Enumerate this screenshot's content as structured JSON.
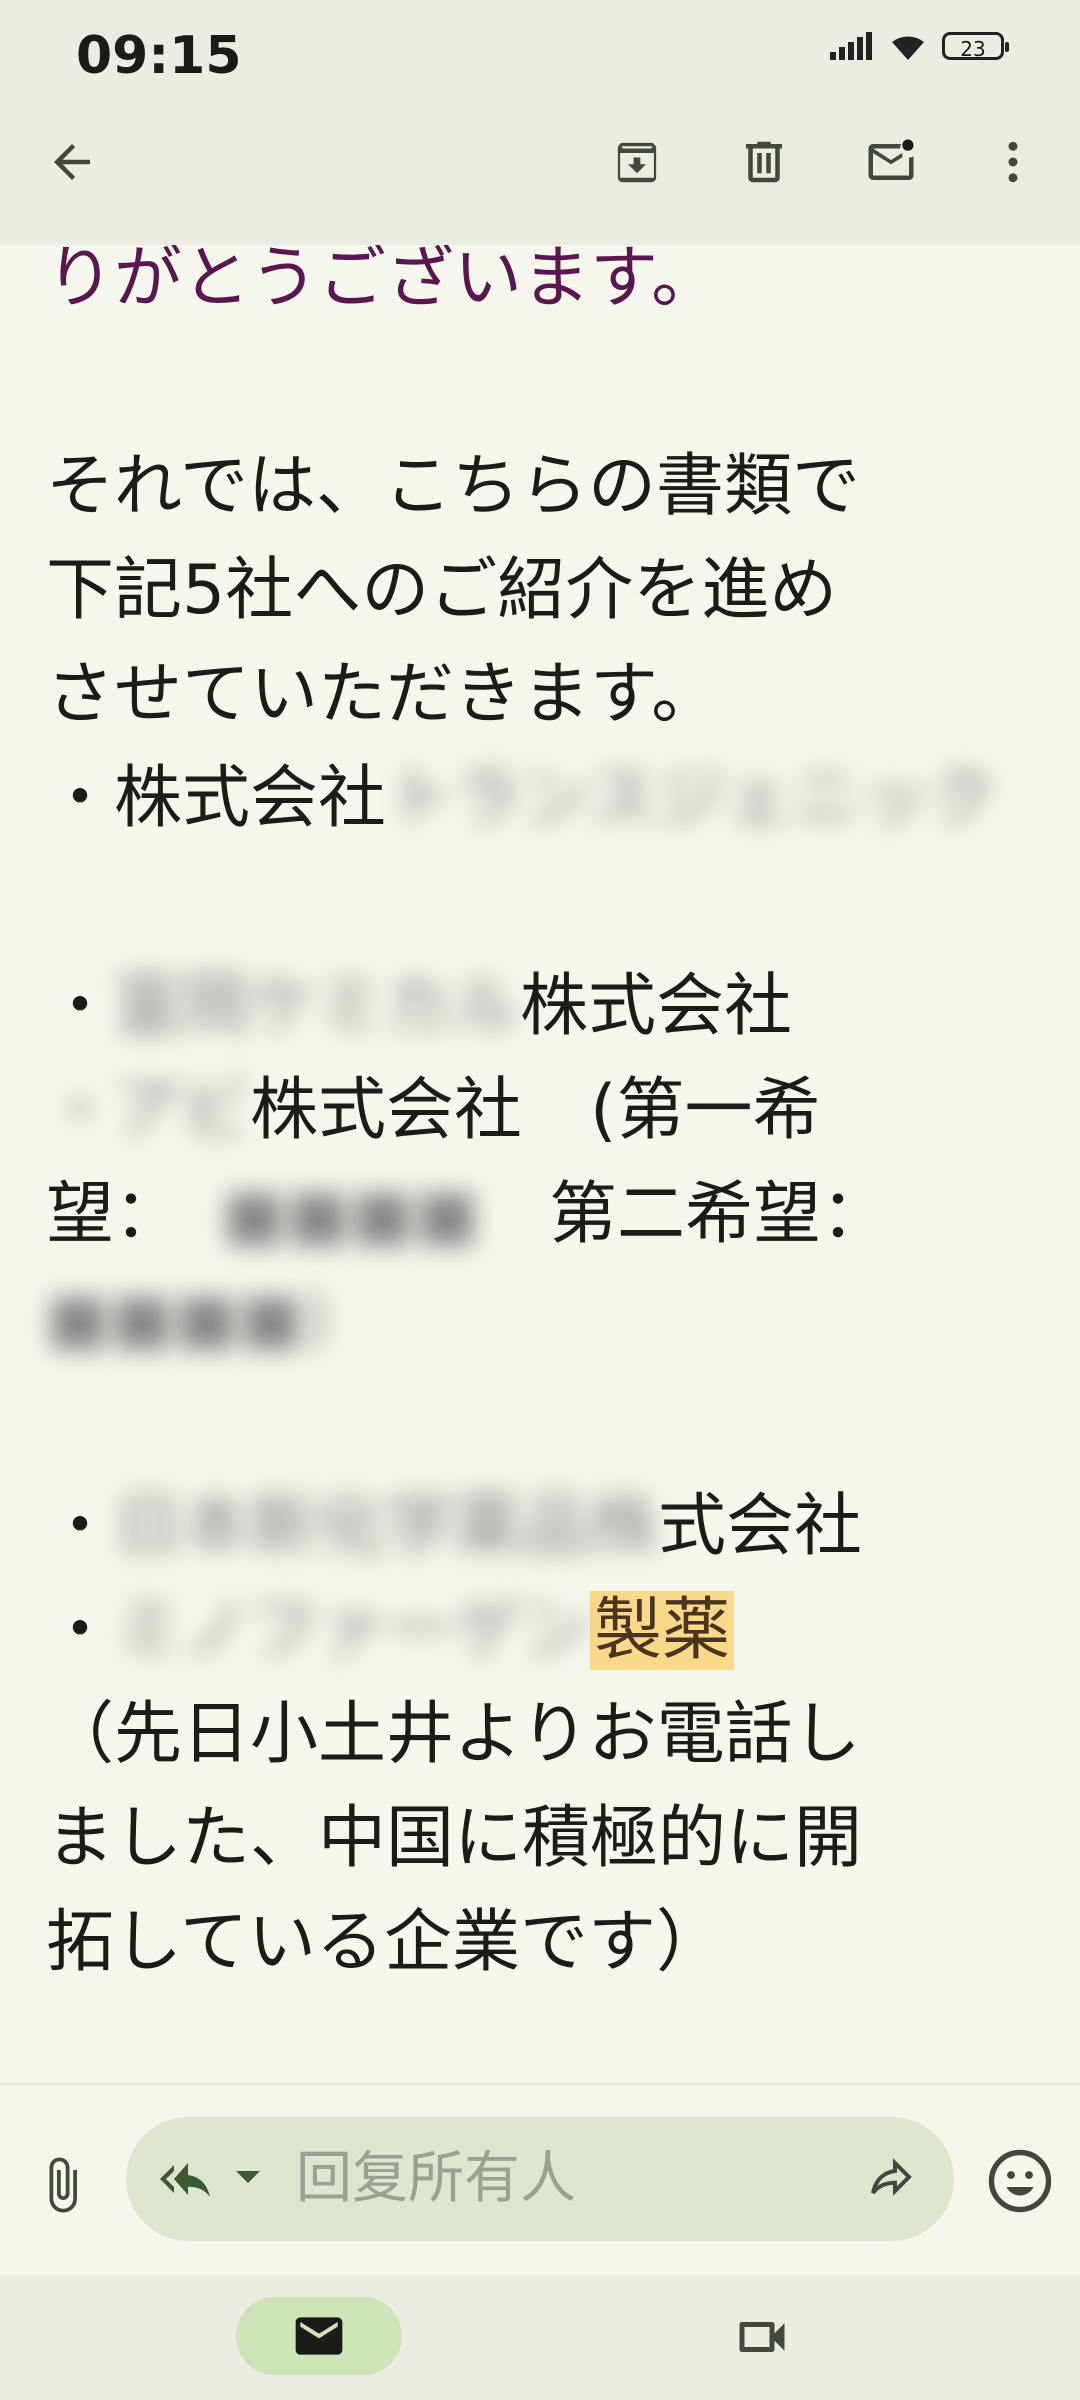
{
  "status_bar": {
    "time": "09:15",
    "battery": "23"
  },
  "toolbar": {
    "back": "back-arrow-icon",
    "archive": "archive-icon",
    "delete": "delete-icon",
    "mark_unread": "mark-unread-icon",
    "more": "more-vertical-icon"
  },
  "email_body": {
    "line_top": "りがとうございます。",
    "intro_line1": "それでは、こちらの書類で",
    "intro_line2": "下記5社へのご紹介を進め",
    "intro_line3": "させていただきます。",
    "item1_prefix": "・株式会社",
    "item1_blurred": "トランスジェニック",
    "item2_bullet": "・",
    "item2_blurred": "富岡ケミカル",
    "item2_suffix": "株式会社",
    "item3_blurred": "・アビ",
    "item3_suffix": "株式会社　(第一希",
    "item3_wish1_label": "望：",
    "item3_wish1_blurred": "■■■■",
    "item3_wish2_label": "第二希望：",
    "item3_wish2_blurred": "■■■■)",
    "item4_bullet": "・",
    "item4_blurred": "日本新化学薬品株",
    "item4_suffix": "式会社",
    "item5_bullet": "・",
    "item5_blurred": "ミノファーゲン",
    "item5_highlight": "製薬",
    "note_line1": "（先日小土井よりお電話し",
    "note_line2": "ました、中国に積極的に開",
    "note_line3": "拓している企業です）"
  },
  "reply_bar": {
    "placeholder": "回复所有人",
    "attach": "attach-icon",
    "reply_all": "reply-all-icon",
    "forward": "forward-icon",
    "emoji": "emoji-icon"
  },
  "bottom_nav": {
    "mail": "mail-icon",
    "meet": "video-icon"
  },
  "colors": {
    "background": "#f5f6ec",
    "bar": "#ebede2",
    "accent_purple": "#5a164f",
    "highlight": "#fbd98a",
    "nav_active": "#cde5b7"
  }
}
